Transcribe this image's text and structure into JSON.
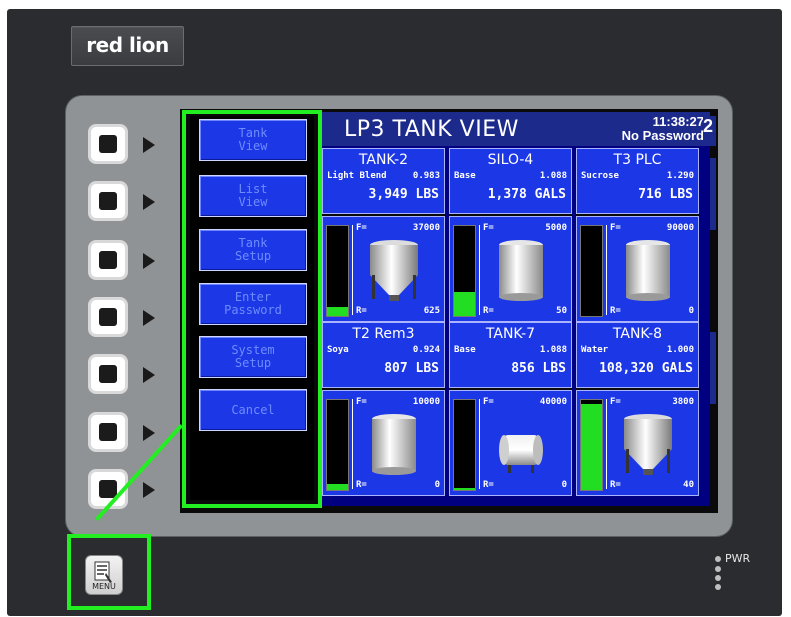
{
  "device": {
    "brand": "red lion",
    "power_label": "PWR",
    "menu_key_label": "MENU"
  },
  "screen": {
    "title": "LP3 TANK VIEW",
    "time": "11:38:27",
    "user": "No Password",
    "edge_chars": [
      "2",
      "0",
      "S",
      "0",
      "S"
    ]
  },
  "menu": {
    "items": [
      {
        "label": "Tank\nView"
      },
      {
        "label": "List\nView"
      },
      {
        "label": "Tank\nSetup"
      },
      {
        "label": "Enter\nPassword"
      },
      {
        "label": "System\nSetup"
      },
      {
        "label": "Cancel"
      }
    ]
  },
  "tanks": [
    {
      "name": "TANK-2",
      "product": "Light Blend",
      "sg": "0.983",
      "quantity": "3,949 LBS",
      "f_label": "F=",
      "full": "37000",
      "r_label": "R=",
      "reserve": "625",
      "level": 0.1,
      "shape": "cone"
    },
    {
      "name": "SILO-4",
      "product": "Base",
      "sg": "1.088",
      "quantity": "1,378 GALS",
      "f_label": "F=",
      "full": "5000",
      "r_label": "R=",
      "reserve": "50",
      "level": 0.27,
      "shape": "cylinder"
    },
    {
      "name": "T3 PLC",
      "product": "Sucrose",
      "sg": "1.290",
      "quantity": "716 LBS",
      "f_label": "F=",
      "full": "90000",
      "r_label": "R=",
      "reserve": "0",
      "level": 0.0,
      "shape": "cylinder"
    },
    {
      "name": "T2 Rem3",
      "product": "Soya",
      "sg": "0.924",
      "quantity": "807 LBS",
      "f_label": "F=",
      "full": "10000",
      "r_label": "R=",
      "reserve": "0",
      "level": 0.07,
      "shape": "cylinder"
    },
    {
      "name": "TANK-7",
      "product": "Base",
      "sg": "1.088",
      "quantity": "856 LBS",
      "f_label": "F=",
      "full": "40000",
      "r_label": "R=",
      "reserve": "0",
      "level": 0.02,
      "shape": "horizontal"
    },
    {
      "name": "TANK-8",
      "product": "Water",
      "sg": "1.000",
      "quantity": "108,320 GALS",
      "f_label": "F=",
      "full": "3800",
      "r_label": "R=",
      "reserve": "40",
      "level": 0.96,
      "shape": "cone"
    }
  ],
  "colors": {
    "tile_blue": "#1c37e6",
    "highlight": "#22ee22",
    "level_fill": "#22dd22"
  }
}
